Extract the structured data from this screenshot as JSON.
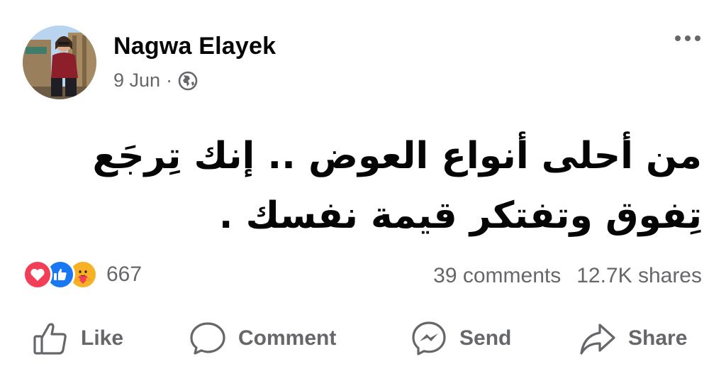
{
  "post": {
    "author": "Nagwa Elayek",
    "date": "9 Jun",
    "separator": "·",
    "audience_icon": "globe-icon",
    "text_line1": "من أحلى أنواع العوض .. إنك تِرجَع",
    "text_line2": "تِفوق وتفتكر قيمة نفسك ."
  },
  "reactions": {
    "types": [
      "love",
      "like",
      "care"
    ],
    "count": "667"
  },
  "stats": {
    "comments": "39 comments",
    "shares": "12.7K shares"
  },
  "actions": {
    "like_label": "Like",
    "comment_label": "Comment",
    "send_label": "Send",
    "share_label": "Share"
  },
  "colors": {
    "text_primary": "#050505",
    "text_secondary": "#65676b",
    "love": "#f33e58",
    "like": "#1877f2",
    "care": "#f7b125"
  }
}
